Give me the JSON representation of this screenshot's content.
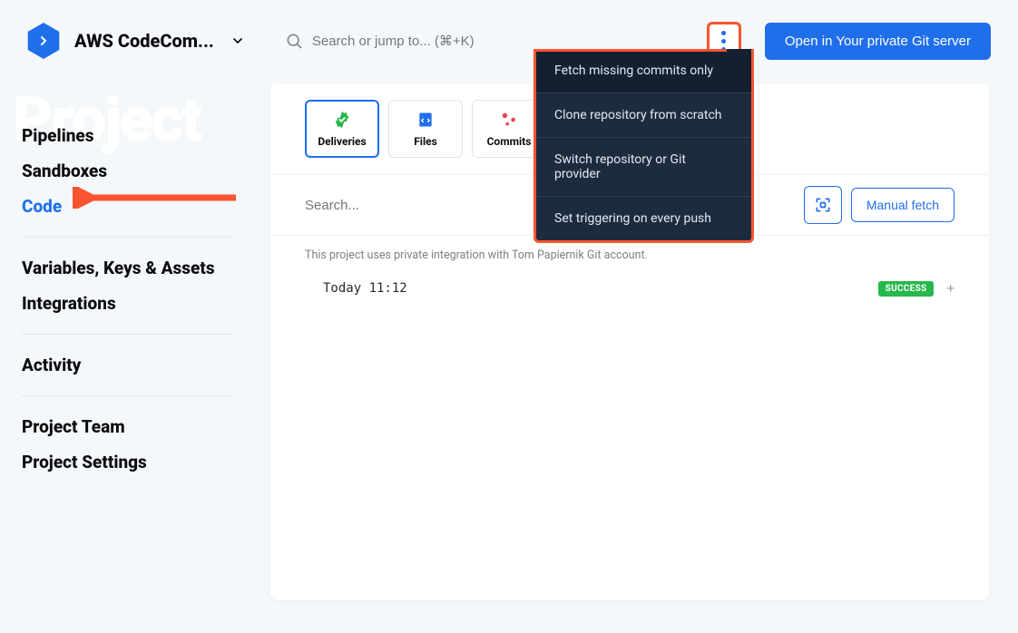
{
  "header": {
    "project_title": "AWS CodeCom...",
    "search_placeholder": "Search or jump to... (⌘+K)",
    "open_git_label": "Open in Your private Git server"
  },
  "sidebar": {
    "items": [
      {
        "label": "Pipelines",
        "active": false
      },
      {
        "label": "Sandboxes",
        "active": false
      },
      {
        "label": "Code",
        "active": true
      }
    ],
    "group2": [
      {
        "label": "Variables, Keys & Assets"
      },
      {
        "label": "Integrations"
      }
    ],
    "group3": [
      {
        "label": "Activity"
      }
    ],
    "group4": [
      {
        "label": "Project Team"
      },
      {
        "label": "Project Settings"
      }
    ]
  },
  "tabs": [
    {
      "label": "Deliveries",
      "icon": "badge-check",
      "active": true
    },
    {
      "label": "Files",
      "icon": "code-file",
      "active": false
    },
    {
      "label": "Commits",
      "icon": "commit-nodes",
      "active": false
    }
  ],
  "filter": {
    "search_placeholder": "Search...",
    "manual_fetch_label": "Manual fetch"
  },
  "info_text": "This project uses private integration with Tom Papiernik Git account.",
  "rows": [
    {
      "time": "Today 11:12",
      "badge": "SUCCESS"
    }
  ],
  "dropdown": {
    "items": [
      {
        "label": "Fetch missing commits only",
        "highlighted": true
      },
      {
        "label": "Clone repository from scratch",
        "highlighted": false
      },
      {
        "label": "Switch repository or Git provider",
        "highlighted": false
      },
      {
        "label": "Set triggering on every push",
        "highlighted": false
      }
    ]
  },
  "watermark": "Project"
}
